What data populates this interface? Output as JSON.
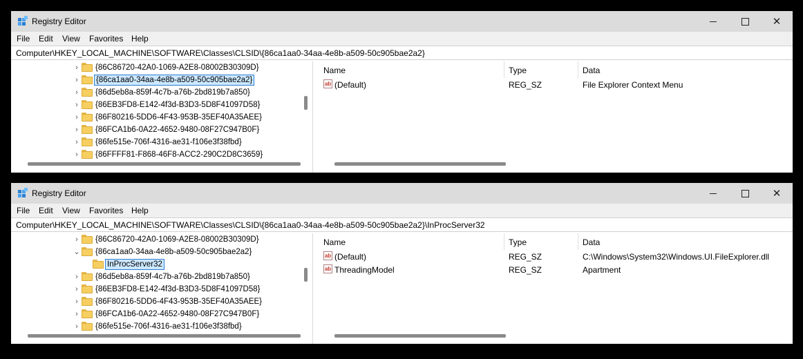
{
  "w1": {
    "title": "Registry Editor",
    "menu": [
      "File",
      "Edit",
      "View",
      "Favorites",
      "Help"
    ],
    "address": "Computer\\HKEY_LOCAL_MACHINE\\SOFTWARE\\Classes\\CLSID\\{86ca1aa0-34aa-4e8b-a509-50c905bae2a2}",
    "tree": [
      {
        "label": "{86C86720-42A0-1069-A2E8-08002B30309D}",
        "selected": false
      },
      {
        "label": "{86ca1aa0-34aa-4e8b-a509-50c905bae2a2}",
        "selected": true
      },
      {
        "label": "{86d5eb8a-859f-4c7b-a76b-2bd819b7a850}",
        "selected": false
      },
      {
        "label": "{86EB3FD8-E142-4f3d-B3D3-5D8F41097D58}",
        "selected": false
      },
      {
        "label": "{86F80216-5DD6-4F43-953B-35EF40A35AEE}",
        "selected": false
      },
      {
        "label": "{86FCA1b6-0A22-4652-9480-08F27C947B0F}",
        "selected": false
      },
      {
        "label": "{86fe515e-706f-4316-ae31-f106e3f38fbd}",
        "selected": false
      },
      {
        "label": "{86FFFF81-F868-46F8-ACC2-290C2D8C3659}",
        "selected": false
      }
    ],
    "columns": {
      "name": "Name",
      "type": "Type",
      "data": "Data"
    },
    "values": [
      {
        "name": "(Default)",
        "type": "REG_SZ",
        "data": "File Explorer Context Menu"
      }
    ]
  },
  "w2": {
    "title": "Registry Editor",
    "menu": [
      "File",
      "Edit",
      "View",
      "Favorites",
      "Help"
    ],
    "address": "Computer\\HKEY_LOCAL_MACHINE\\SOFTWARE\\Classes\\CLSID\\{86ca1aa0-34aa-4e8b-a509-50c905bae2a2}\\InProcServer32",
    "tree": [
      {
        "label": "{86C86720-42A0-1069-A2E8-08002B30309D}",
        "selected": false,
        "expanded": false
      },
      {
        "label": "{86ca1aa0-34aa-4e8b-a509-50c905bae2a2}",
        "selected": false,
        "expanded": true
      },
      {
        "label": "InProcServer32",
        "selected": true,
        "child": true
      },
      {
        "label": "{86d5eb8a-859f-4c7b-a76b-2bd819b7a850}",
        "selected": false
      },
      {
        "label": "{86EB3FD8-E142-4f3d-B3D3-5D8F41097D58}",
        "selected": false
      },
      {
        "label": "{86F80216-5DD6-4F43-953B-35EF40A35AEE}",
        "selected": false
      },
      {
        "label": "{86FCA1b6-0A22-4652-9480-08F27C947B0F}",
        "selected": false
      },
      {
        "label": "{86fe515e-706f-4316-ae31-f106e3f38fbd}",
        "selected": false
      }
    ],
    "columns": {
      "name": "Name",
      "type": "Type",
      "data": "Data"
    },
    "values": [
      {
        "name": "(Default)",
        "type": "REG_SZ",
        "data": "C:\\Windows\\System32\\Windows.UI.FileExplorer.dll"
      },
      {
        "name": "ThreadingModel",
        "type": "REG_SZ",
        "data": "Apartment"
      }
    ]
  },
  "icons": {
    "app": "registry-editor-icon",
    "folder": "folder-icon",
    "chevron": "chevron-right-icon",
    "value": "string-value-icon"
  },
  "colors": {
    "titlebar": "#dcdcdc",
    "selection": "#cce8ff",
    "selection_border": "#2e7dd1",
    "folder": "#f7cf60"
  }
}
